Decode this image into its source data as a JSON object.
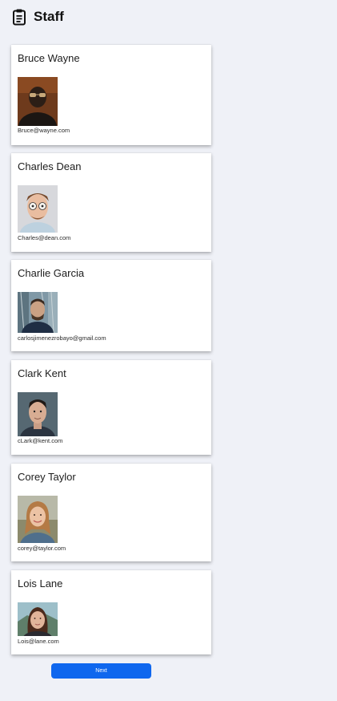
{
  "header": {
    "title": "Staff"
  },
  "staff": [
    {
      "name": "Bruce Wayne",
      "email": "Bruce@wayne.com"
    },
    {
      "name": "Charles Dean",
      "email": "Charles@dean.com"
    },
    {
      "name": "Charlie Garcia",
      "email": "carlosjimenezrobayo@gmail.com"
    },
    {
      "name": "Clark Kent",
      "email": "cLark@kent.com"
    },
    {
      "name": "Corey Taylor",
      "email": "corey@taylor.com"
    },
    {
      "name": "Lois Lane",
      "email": "Lois@lane.com"
    }
  ],
  "actions": {
    "next_label": "Next",
    "accent_color": "#0f67ee"
  }
}
